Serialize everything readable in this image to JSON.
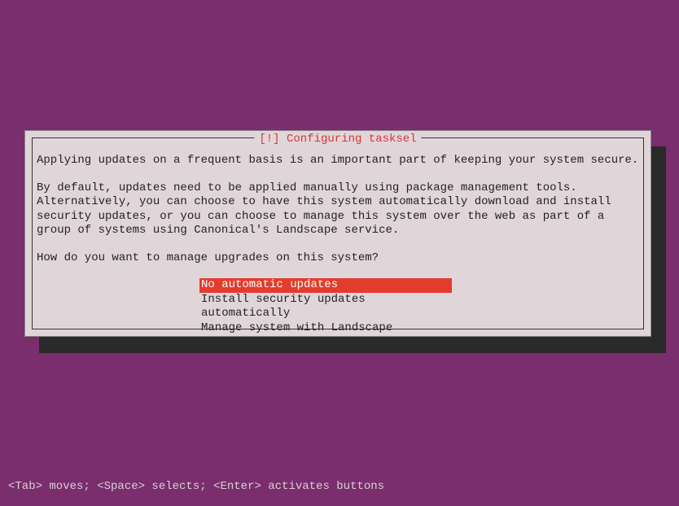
{
  "dialog": {
    "title": "[!] Configuring tasksel",
    "paragraph1": "Applying updates on a frequent basis is an important part of keeping your system secure.",
    "paragraph2": "By default, updates need to be applied manually using package management tools. Alternatively, you can choose to have this system automatically download and install security updates, or you can choose to manage this system over the web as part of a group of systems using Canonical's Landscape service.",
    "question": "How do you want to manage upgrades on this system?",
    "options": [
      "No automatic updates",
      "Install security updates automatically",
      "Manage system with Landscape"
    ],
    "selected_index": 0
  },
  "footer": {
    "hint": "<Tab> moves; <Space> selects; <Enter> activates buttons"
  }
}
